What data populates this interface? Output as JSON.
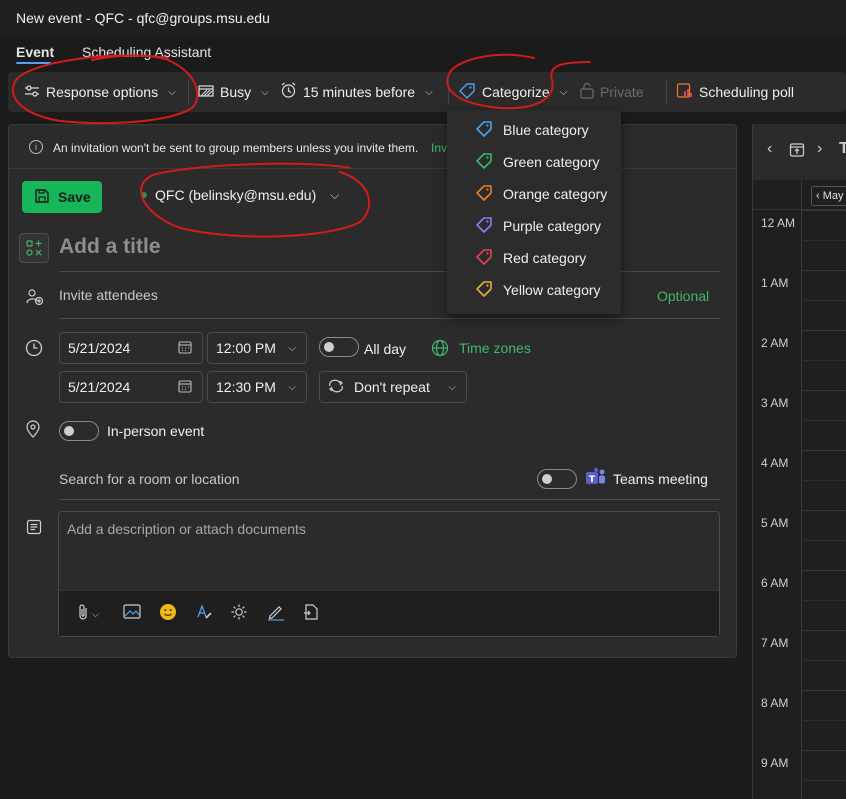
{
  "window": {
    "title": "New event - QFC - qfc@groups.msu.edu"
  },
  "tabs": [
    {
      "label": "Event",
      "active": true
    },
    {
      "label": "Scheduling Assistant",
      "active": false
    }
  ],
  "toolbar": {
    "response_options": "Response options",
    "show_as": "Busy",
    "reminder": "15 minutes before",
    "categorize": "Categorize",
    "private": "Private",
    "scheduling_poll": "Scheduling poll"
  },
  "notice": {
    "message": "An invitation won't be sent to group members unless you invite them.",
    "link": "Inv"
  },
  "form": {
    "save_label": "Save",
    "account": "QFC (belinsky@msu.edu)",
    "title_placeholder": "Add a title",
    "attendees_placeholder": "Invite attendees",
    "optional_label": "Optional",
    "start_date": "5/21/2024",
    "start_time": "12:00 PM",
    "end_date": "5/21/2024",
    "end_time": "12:30 PM",
    "all_day_label": "All day",
    "time_zones_label": "Time zones",
    "repeat_label": "Don't repeat",
    "in_person_label": "In-person event",
    "location_placeholder": "Search for a room or location",
    "teams_label": "Teams meeting",
    "description_placeholder": "Add a description or attach documents"
  },
  "categories": [
    {
      "label": "Blue category",
      "color": "#4aa3f0"
    },
    {
      "label": "Green category",
      "color": "#3fb86a"
    },
    {
      "label": "Orange category",
      "color": "#e8812a"
    },
    {
      "label": "Purple category",
      "color": "#8b7cf0"
    },
    {
      "label": "Red category",
      "color": "#e0454f"
    },
    {
      "label": "Yellow category",
      "color": "#e8b030"
    }
  ],
  "calendar": {
    "header_letter": "T",
    "month_label": "May",
    "hours": [
      "12 AM",
      "1 AM",
      "2 AM",
      "3 AM",
      "4 AM",
      "5 AM",
      "6 AM",
      "7 AM",
      "8 AM",
      "9 AM"
    ]
  },
  "colors": {
    "accent_green": "#17b65b",
    "link_green": "#3fb86a",
    "annotation_red": "#d01c1c",
    "tab_underline": "#4ca3f5"
  }
}
